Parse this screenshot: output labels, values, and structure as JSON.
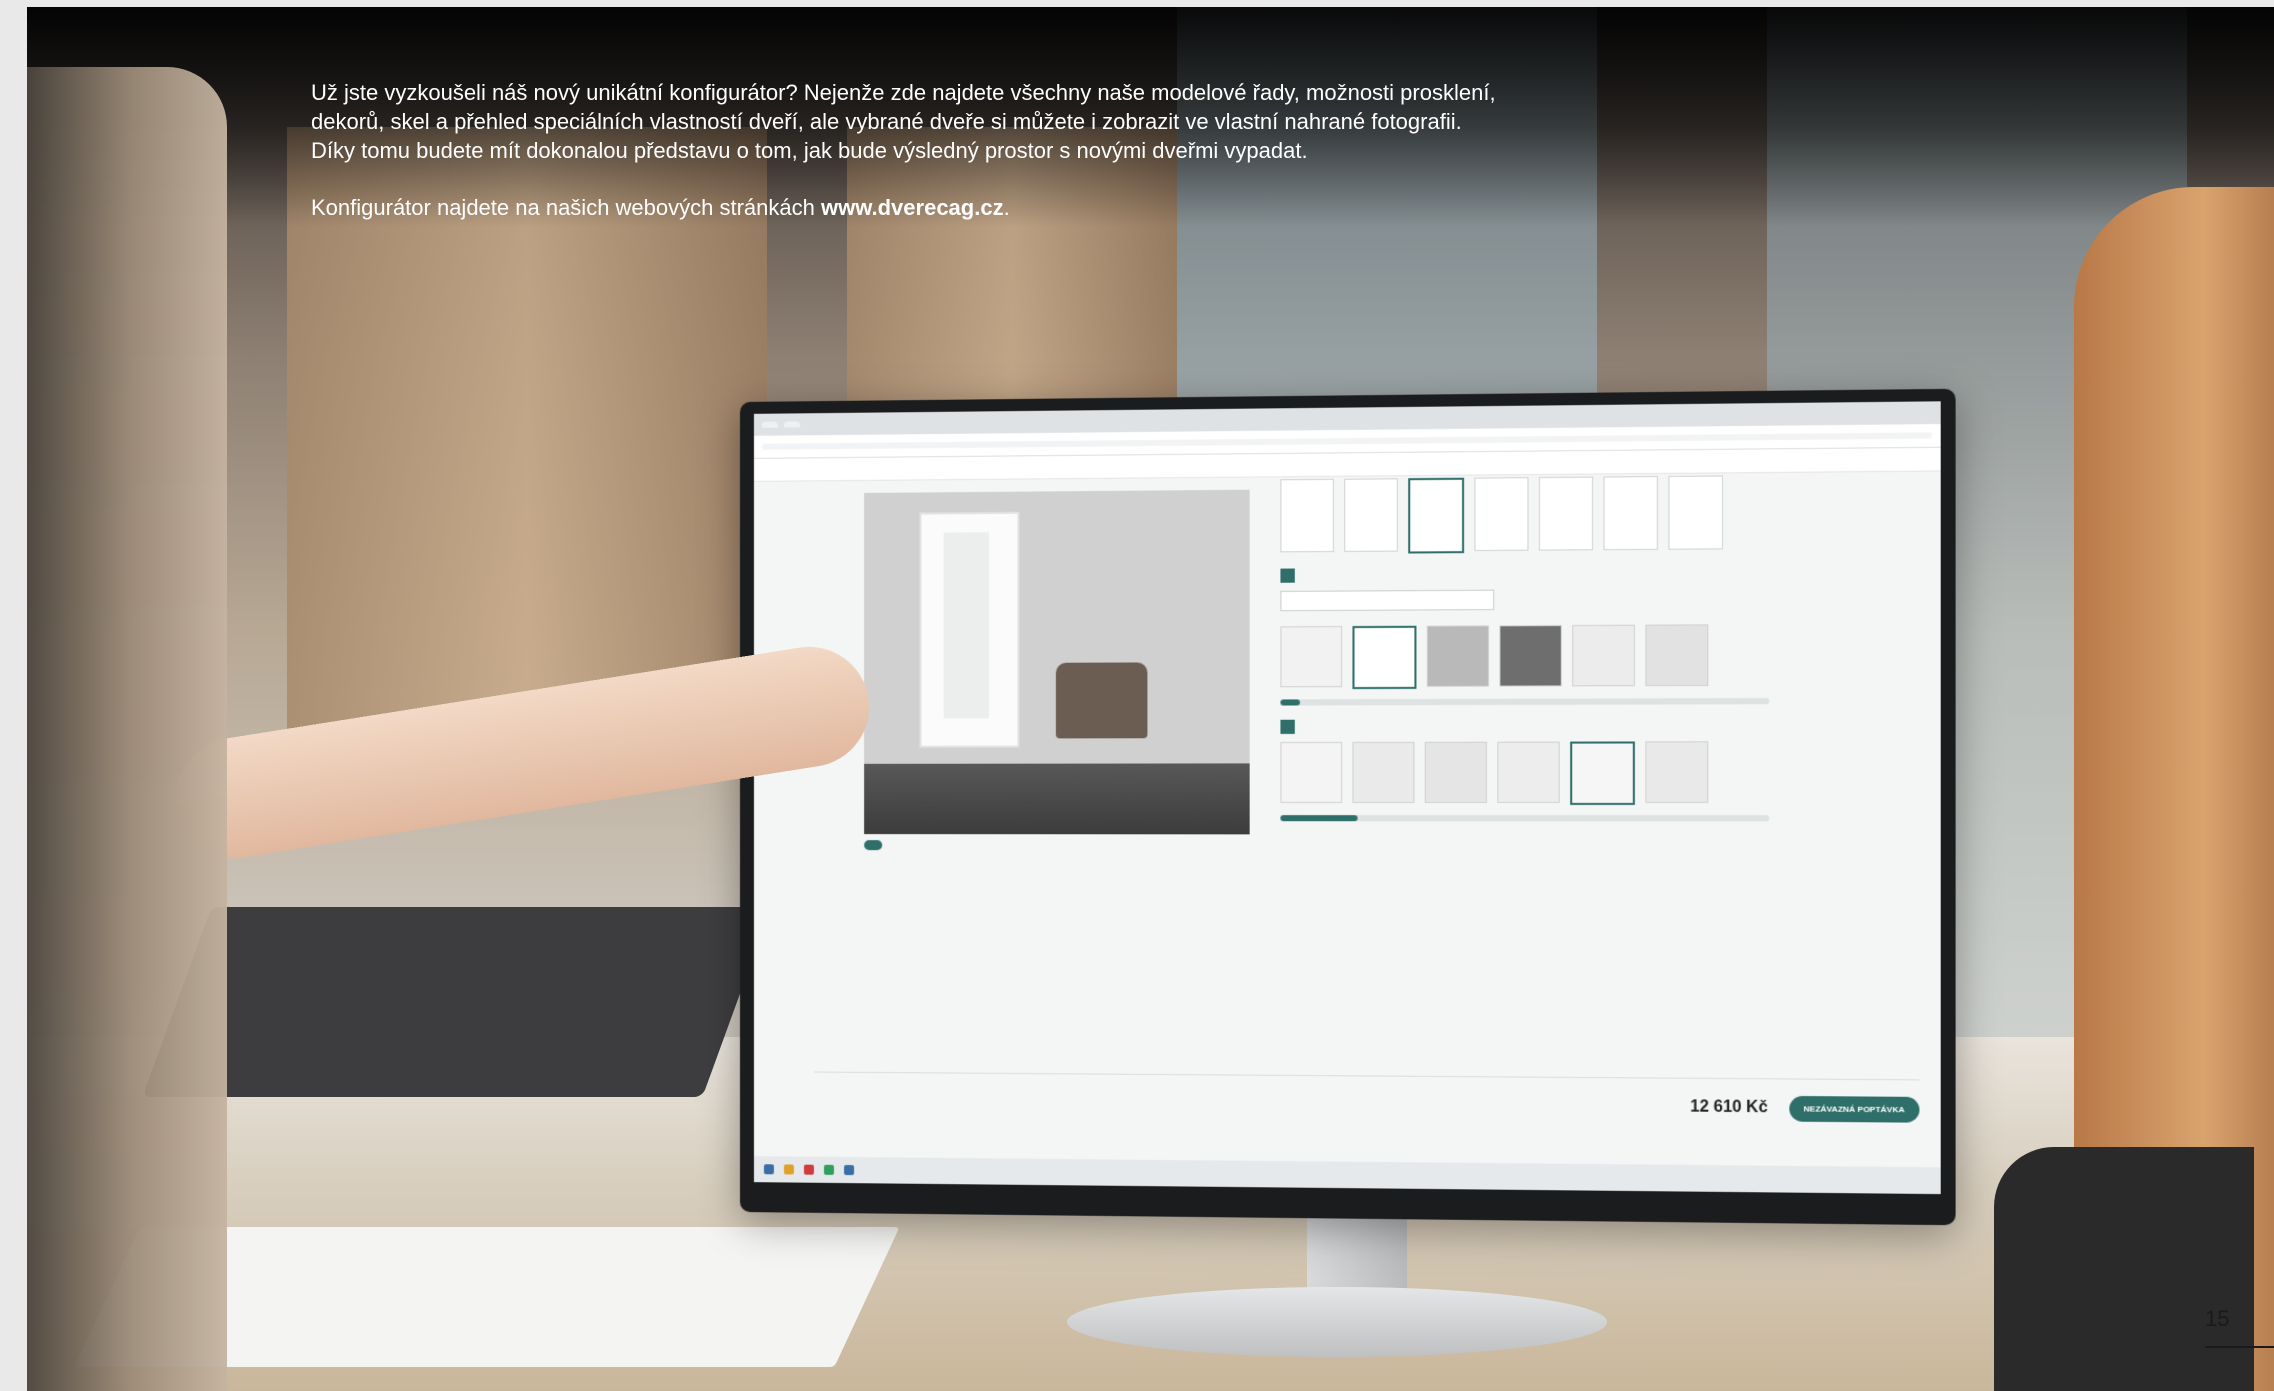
{
  "text": {
    "para1_line1": "Už jste vyzkoušeli náš nový unikátní konfigurátor? Nejenže zde najdete všechny naše modelové řady, možnosti prosklení,",
    "para1_line2": "dekorů, skel a přehled speciálních vlastností dveří, ale vybrané dveře si můžete i zobrazit ve vlastní nahrané fotografii.",
    "para1_line3": "Díky tomu budete mít dokonalou představu o tom, jak bude výsledný prostor s novými dveřmi vypadat.",
    "para2_prefix": "Konfigurátor najdete na našich webových stránkách ",
    "website": "www.dverecag.cz",
    "para2_suffix": "."
  },
  "page_number": "15",
  "screen": {
    "price": "12 610 Kč",
    "cta_label": "NEZÁVAZNÁ POPTÁVKA"
  },
  "colors": {
    "accent": "#2f6f6a",
    "text_on_photo": "#ffffff",
    "page_number": "#1a1a1a"
  }
}
